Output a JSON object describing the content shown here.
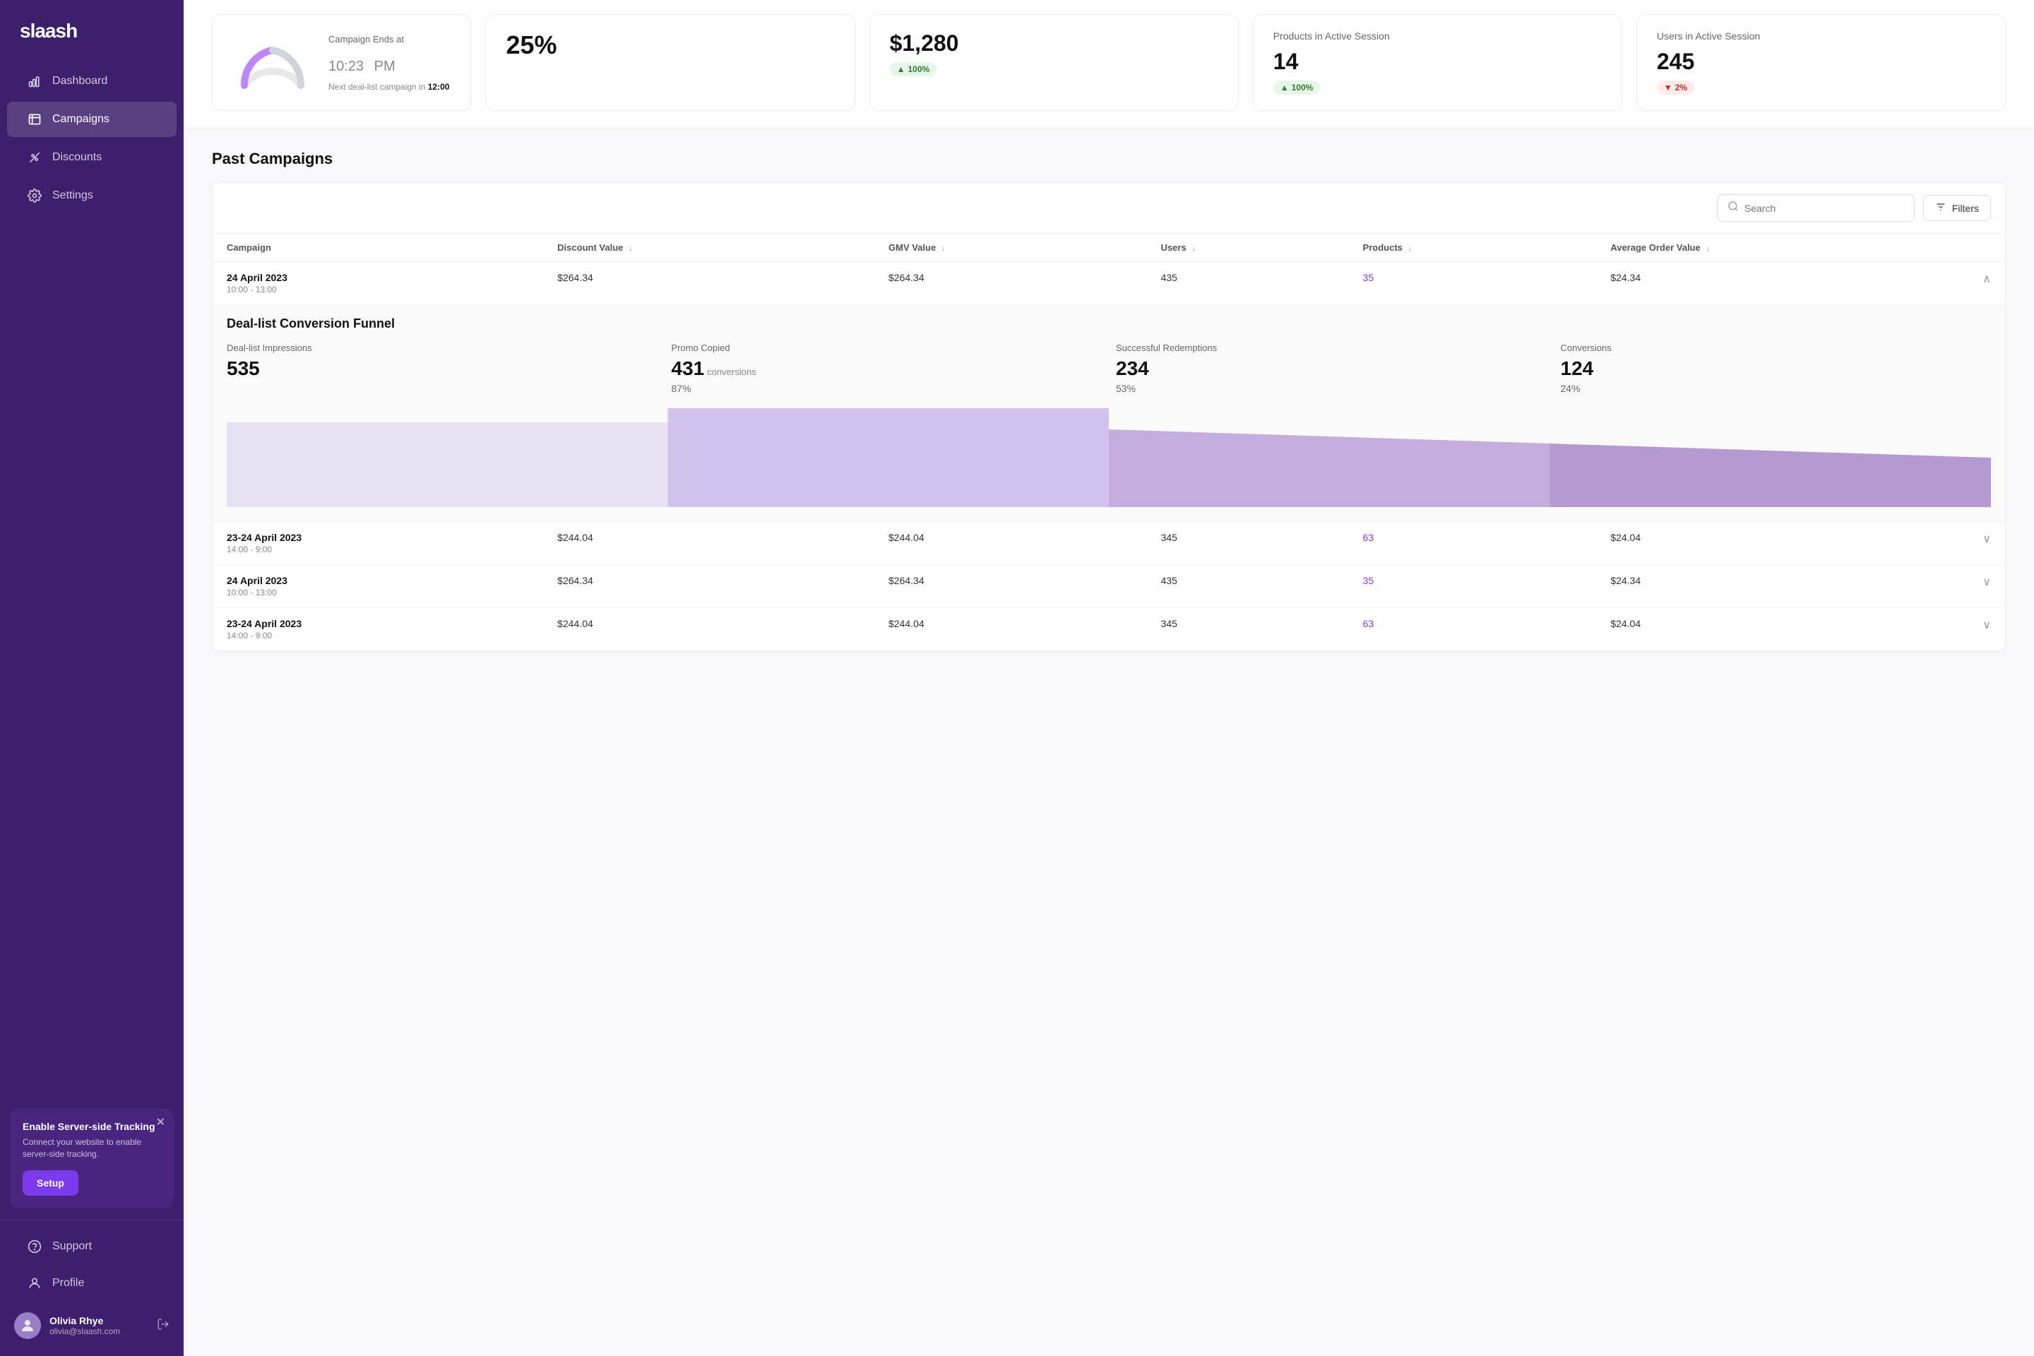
{
  "sidebar": {
    "logo": "slaash",
    "nav_items": [
      {
        "id": "dashboard",
        "label": "Dashboard",
        "icon": "chart-icon",
        "active": false
      },
      {
        "id": "campaigns",
        "label": "Campaigns",
        "icon": "campaigns-icon",
        "active": true
      },
      {
        "id": "discounts",
        "label": "Discounts",
        "icon": "discounts-icon",
        "active": false
      },
      {
        "id": "settings",
        "label": "Settings",
        "icon": "settings-icon",
        "active": false
      }
    ],
    "bottom_nav": [
      {
        "id": "support",
        "label": "Support",
        "icon": "support-icon"
      },
      {
        "id": "profile",
        "label": "Profile",
        "icon": "profile-icon"
      }
    ],
    "notification": {
      "title": "Enable Server-side Tracking",
      "description": "Connect your website to enable server-side tracking.",
      "button_label": "Setup"
    },
    "user": {
      "name": "Olivia Rhye",
      "email": "olivia@slaash.com"
    }
  },
  "top_stats": {
    "timer": {
      "label": "Campaign Ends at",
      "time": "10:23",
      "period": "PM",
      "next_label": "Next deal-list campaign in",
      "next_time": "12:00"
    },
    "stat_cards": [
      {
        "label": "25%",
        "value": "25%",
        "badge": "",
        "badge_type": ""
      },
      {
        "label": "",
        "value": "$1,280",
        "badge": "100%",
        "badge_type": "up"
      },
      {
        "label": "Products in Active Session",
        "value": "14",
        "badge": "100%",
        "badge_type": "up"
      },
      {
        "label": "Users in Active Session",
        "value": "245",
        "badge": "2%",
        "badge_type": "down"
      }
    ]
  },
  "past_campaigns": {
    "title": "Past Campaigns",
    "search_placeholder": "Search",
    "filters_label": "Filters",
    "columns": [
      {
        "label": "Campaign",
        "key": "campaign"
      },
      {
        "label": "Discount Value",
        "key": "discount_value"
      },
      {
        "label": "GMV Value",
        "key": "gmv_value"
      },
      {
        "label": "Users",
        "key": "users"
      },
      {
        "label": "Products",
        "key": "products"
      },
      {
        "label": "Average Order Value",
        "key": "avg_order_value"
      }
    ],
    "rows": [
      {
        "date": "24 April 2023",
        "time": "10:00 - 13:00",
        "discount_value": "$264.34",
        "gmv_value": "$264.34",
        "users": "435",
        "products": "35",
        "avg_order_value": "$24.34",
        "expanded": true,
        "funnel": {
          "title": "Deal-list Conversion Funnel",
          "stats": [
            {
              "label": "Deal-list Impressions",
              "value": "535",
              "suffix": "",
              "pct": ""
            },
            {
              "label": "Promo Copied",
              "value": "431",
              "suffix": "conversions",
              "pct": "87%"
            },
            {
              "label": "Successful Redemptions",
              "value": "234",
              "suffix": "",
              "pct": "53%"
            },
            {
              "label": "Conversions",
              "value": "124",
              "suffix": "",
              "pct": "24%"
            }
          ]
        }
      },
      {
        "date": "23-24 April 2023",
        "time": "14:00 - 9:00",
        "discount_value": "$244.04",
        "gmv_value": "$244.04",
        "users": "345",
        "products": "63",
        "avg_order_value": "$24.04",
        "expanded": false
      },
      {
        "date": "24 April 2023",
        "time": "10:00 - 13:00",
        "discount_value": "$264.34",
        "gmv_value": "$264.34",
        "users": "435",
        "products": "35",
        "avg_order_value": "$24.34",
        "expanded": false
      },
      {
        "date": "23-24 April 2023",
        "time": "14:00 - 9:00",
        "discount_value": "$244.04",
        "gmv_value": "$244.04",
        "users": "345",
        "products": "63",
        "avg_order_value": "$24.04",
        "expanded": false
      }
    ]
  },
  "colors": {
    "sidebar_bg": "#3d1f6e",
    "active_nav": "rgba(255,255,255,0.15)",
    "purple_accent": "#7c3aed",
    "funnel_light": "#e8dff7",
    "funnel_medium": "#c4aee8",
    "badge_up_bg": "#e8f5e9",
    "badge_up_text": "#2e7d32",
    "badge_down_bg": "#fdecea",
    "badge_down_text": "#c62828"
  }
}
